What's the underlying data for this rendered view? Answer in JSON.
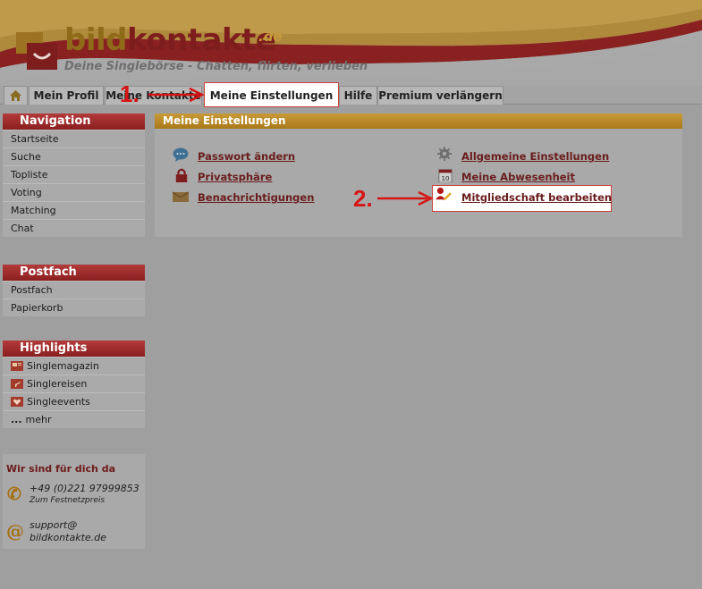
{
  "header": {
    "logo_word_1": "bild",
    "logo_word_2": "kontakte",
    "logo_tld": ".de",
    "tagline": "Deine Singlebörse - Chatten, flirten, verlieben"
  },
  "tabs": {
    "home_icon": "home-icon",
    "items": [
      {
        "label": "Mein Profil"
      },
      {
        "label": "Meine Kontakte"
      },
      {
        "label": "Meine Einstellungen",
        "active": true
      },
      {
        "label": "Hilfe"
      },
      {
        "label": "Premium verlängern"
      }
    ]
  },
  "sidebar": {
    "navigation": {
      "title": "Navigation",
      "items": [
        "Startseite",
        "Suche",
        "Topliste",
        "Voting",
        "Matching",
        "Chat"
      ]
    },
    "postfach": {
      "title": "Postfach",
      "items": [
        "Postfach",
        "Papierkorb"
      ]
    },
    "highlights": {
      "title": "Highlights",
      "items": [
        {
          "label": "Singlemagazin",
          "icon": "magazine-icon"
        },
        {
          "label": "Singlereisen",
          "icon": "travel-icon"
        },
        {
          "label": "Singleevents",
          "icon": "heart-calendar-icon"
        },
        {
          "label": "mehr",
          "prefix": "..."
        }
      ]
    },
    "contact": {
      "title": "Wir sind für dich da",
      "phone": "+49 (0)221 97999853",
      "phone_note": "Zum Festnetzpreis",
      "email_line1": "support@",
      "email_line2": "bildkontakte.de"
    }
  },
  "main": {
    "title": "Meine Einstellungen",
    "links": [
      {
        "label": "Passwort ändern",
        "icon": "chat-bubble-icon"
      },
      {
        "label": "Privatsphäre",
        "icon": "lock-icon"
      },
      {
        "label": "Benachrichtigungen",
        "icon": "notification-box-icon"
      },
      {
        "label": "Allgemeine Einstellungen",
        "icon": "gear-icon"
      },
      {
        "label": "Meine Abwesenheit",
        "icon": "calendar-icon",
        "icon_text": "10"
      },
      {
        "label": "Mitgliedschaft bearbeiten",
        "icon": "user-edit-icon"
      }
    ]
  },
  "annotations": {
    "step1": "1.",
    "step2": "2.",
    "color": "#d61414"
  },
  "colors": {
    "overlay_gray": "#9f9f9f",
    "nav_red": "#8a1f1f",
    "main_gold": "#b8861f",
    "link_red": "#6a1c1c",
    "highlight_border": "#c8413a"
  }
}
